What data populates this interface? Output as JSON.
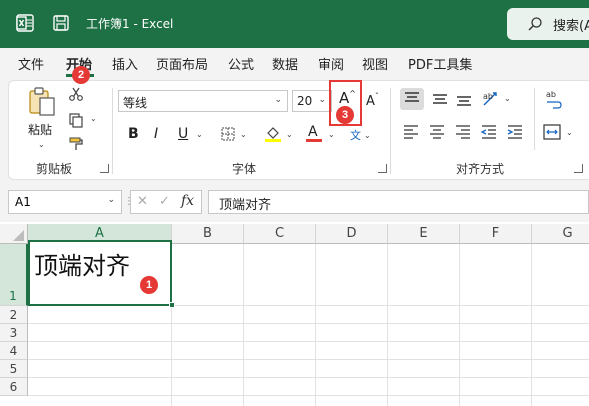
{
  "titlebar": {
    "title": "工作簿1  -  Excel",
    "search_label": "搜索(A",
    "colors": {
      "brand": "#1e7145"
    }
  },
  "menu": {
    "items": [
      {
        "label": "文件"
      },
      {
        "label": "开始"
      },
      {
        "label": "插入"
      },
      {
        "label": "页面布局"
      },
      {
        "label": "公式"
      },
      {
        "label": "数据"
      },
      {
        "label": "审阅"
      },
      {
        "label": "视图"
      },
      {
        "label": "PDF工具集"
      }
    ],
    "active_index": 1
  },
  "ribbon": {
    "clipboard": {
      "paste_label": "粘贴",
      "group_label": "剪贴板"
    },
    "font": {
      "font_name": "等线",
      "font_size": "20",
      "increase_font": "A",
      "decrease_font": "A",
      "bold": "B",
      "italic": "I",
      "underline": "U",
      "font_color_letter": "A",
      "phonetic": "文",
      "group_label": "字体"
    },
    "alignment": {
      "group_label": "对齐方式"
    }
  },
  "annotations": {
    "badge1": "1",
    "badge2": "2",
    "badge3": "3"
  },
  "formula_bar": {
    "name_box": "A1",
    "fx": "fx",
    "content": "顶端对齐"
  },
  "grid": {
    "columns": [
      "A",
      "B",
      "C",
      "D",
      "E",
      "F",
      "G"
    ],
    "rows": [
      "1",
      "2",
      "3",
      "4",
      "5",
      "6"
    ],
    "active_cell": "A1",
    "a1_value": "顶端对齐"
  }
}
